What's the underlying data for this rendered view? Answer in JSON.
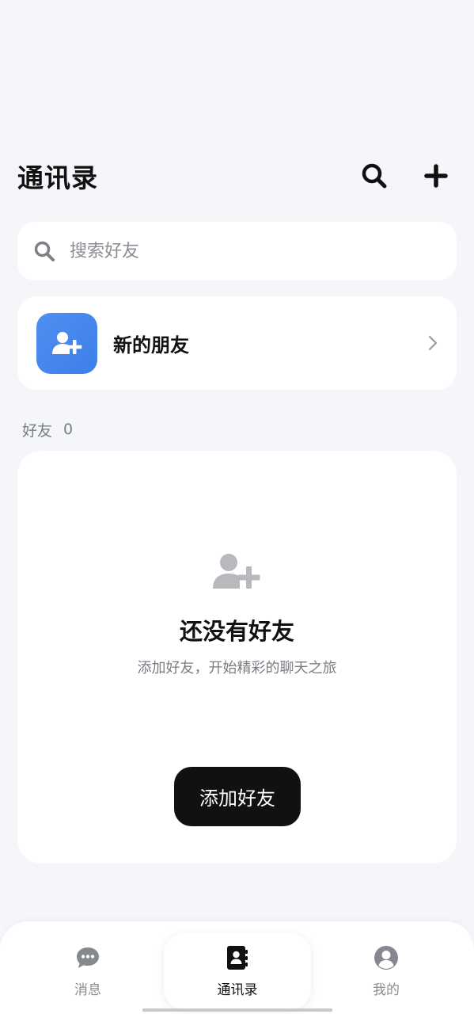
{
  "header": {
    "title": "通讯录",
    "search_icon": "search-icon",
    "add_icon": "plus-icon"
  },
  "search": {
    "placeholder": "搜索好友",
    "value": ""
  },
  "new_friends": {
    "label": "新的朋友",
    "icon": "add-user-icon",
    "accent": "#4a8af0"
  },
  "friends_section": {
    "label": "好友",
    "count": "0"
  },
  "empty_state": {
    "icon": "add-user-icon",
    "title": "还没有好友",
    "subtitle": "添加好友，开始精彩的聊天之旅",
    "button_label": "添加好友"
  },
  "tabbar": {
    "items": [
      {
        "label": "消息",
        "icon": "chat-bubble-icon",
        "active": false
      },
      {
        "label": "通讯录",
        "icon": "contacts-book-icon",
        "active": true
      },
      {
        "label": "我的",
        "icon": "user-circle-icon",
        "active": false
      }
    ]
  }
}
